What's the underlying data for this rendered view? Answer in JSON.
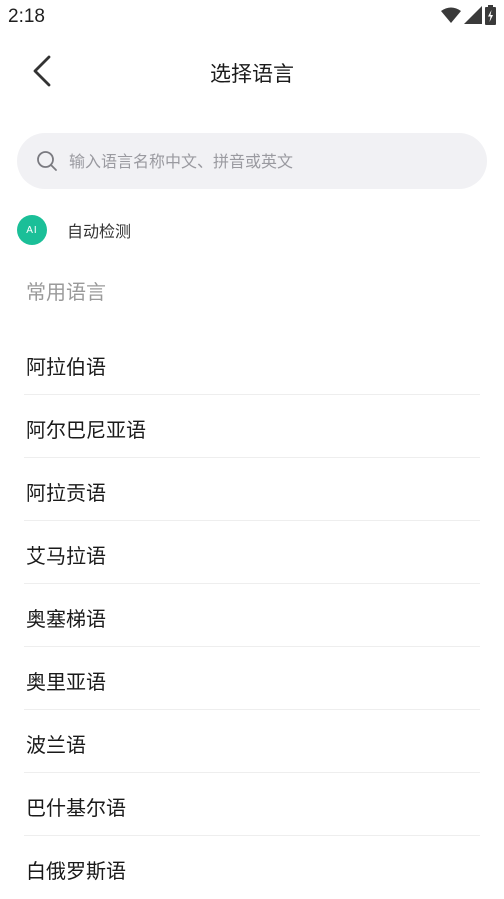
{
  "status_bar": {
    "time": "2:18",
    "icons": [
      "wifi-icon",
      "signal-icon",
      "battery-icon"
    ]
  },
  "header": {
    "title": "选择语言"
  },
  "search": {
    "placeholder": "输入语言名称中文、拼音或英文"
  },
  "auto_detect": {
    "badge": "AI",
    "label": "自动检测",
    "badge_color": "#1bbf98"
  },
  "section": {
    "title": "常用语言"
  },
  "languages": [
    "阿拉伯语",
    "阿尔巴尼亚语",
    "阿拉贡语",
    "艾马拉语",
    "奥塞梯语",
    "奥里亚语",
    "波兰语",
    "巴什基尔语",
    "白俄罗斯语"
  ]
}
